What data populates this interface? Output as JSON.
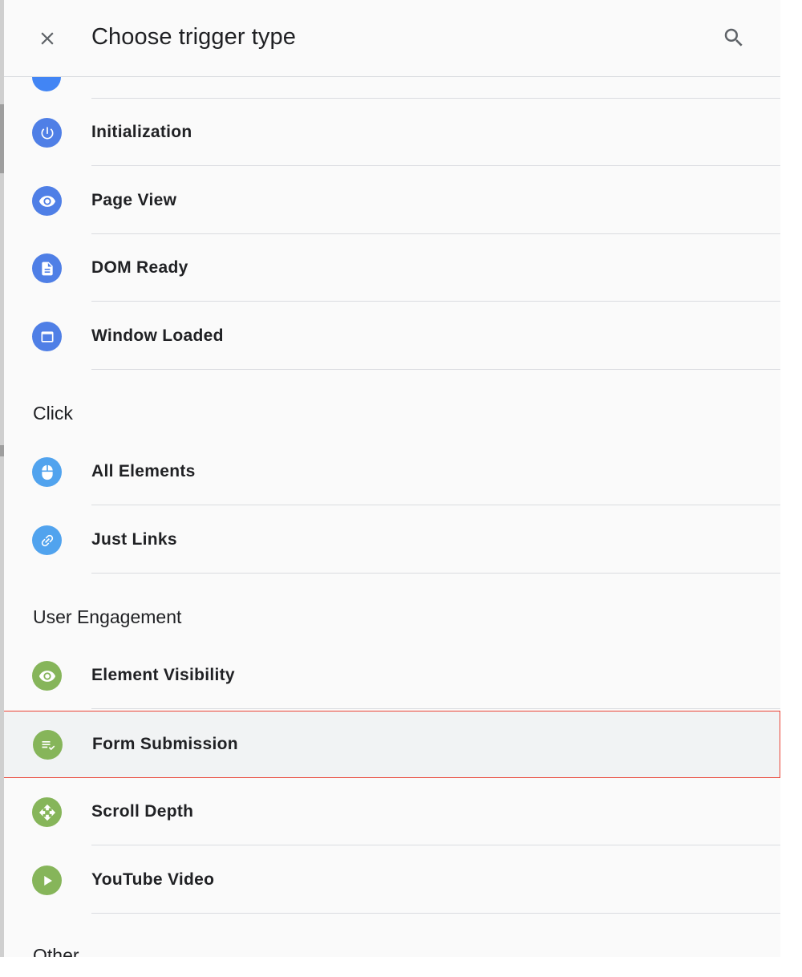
{
  "header": {
    "title": "Choose trigger type",
    "close_icon": "close-icon",
    "search_icon": "search-icon"
  },
  "sections": [
    {
      "label": "",
      "items": [
        {
          "label": "Initialization",
          "icon": "power-icon",
          "color": "#4f7fe6"
        },
        {
          "label": "Page View",
          "icon": "eye-icon",
          "color": "#4f7fe6"
        },
        {
          "label": "DOM Ready",
          "icon": "document-icon",
          "color": "#4f7fe6"
        },
        {
          "label": "Window Loaded",
          "icon": "window-icon",
          "color": "#4f7fe6"
        }
      ]
    },
    {
      "label": "Click",
      "items": [
        {
          "label": "All Elements",
          "icon": "mouse-icon",
          "color": "#51a3ee"
        },
        {
          "label": "Just Links",
          "icon": "link-icon",
          "color": "#51a3ee"
        }
      ]
    },
    {
      "label": "User Engagement",
      "items": [
        {
          "label": "Element Visibility",
          "icon": "eye-icon",
          "color": "#86b55a"
        },
        {
          "label": "Form Submission",
          "icon": "form-check-icon",
          "color": "#86b55a",
          "selected": true
        },
        {
          "label": "Scroll Depth",
          "icon": "move-arrows-icon",
          "color": "#86b55a"
        },
        {
          "label": "YouTube Video",
          "icon": "play-icon",
          "color": "#86b55a"
        }
      ]
    },
    {
      "label": "Other",
      "items": []
    }
  ],
  "colors": {
    "selected_border": "#ea4335",
    "selected_background": "#f1f3f4",
    "page_view_blue": "#4f7fe6",
    "click_blue": "#51a3ee",
    "engagement_green": "#86b55a"
  }
}
